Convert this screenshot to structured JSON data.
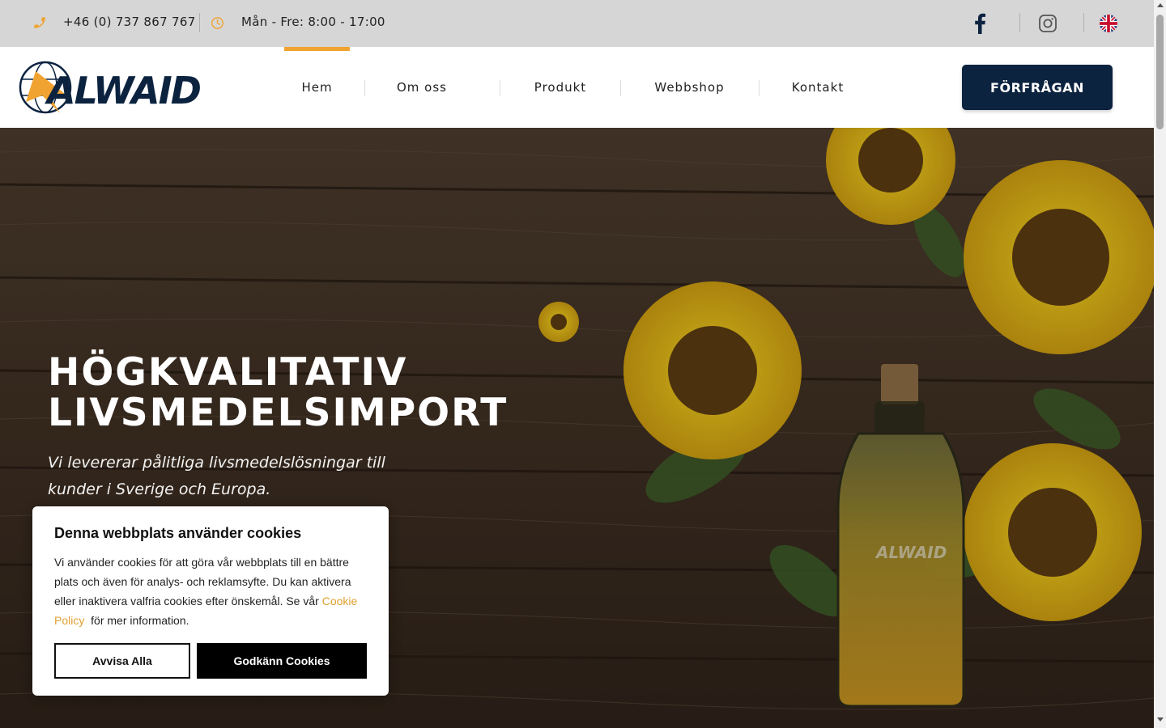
{
  "topbar": {
    "phone": "+46 (0) 737 867 767",
    "hours": "Mån - Fre: 8:00 - 17:00",
    "icons": [
      "phone-icon",
      "clock-icon",
      "facebook-icon",
      "instagram-icon",
      "uk-flag-icon"
    ]
  },
  "header": {
    "logo_text": "ALWAID",
    "nav": [
      {
        "label": "Hem",
        "active": true
      },
      {
        "label": "Om oss",
        "active": false
      },
      {
        "label": "Produkt",
        "active": false
      },
      {
        "label": "Webbshop",
        "active": false
      },
      {
        "label": "Kontakt",
        "active": false
      }
    ],
    "cta_label": "FÖRFRÅGAN"
  },
  "hero": {
    "title_line1": "HÖGKVALITATIV",
    "title_line2": "LIVSMEDELSIMPORT",
    "subtitle": "Vi levererar pålitliga livsmedelslösningar till kunder i Sverige och Europa.",
    "bottle_label": "ALWAID"
  },
  "cookie": {
    "title": "Denna webbplats använder cookies",
    "text_before": "Vi använder cookies för att göra vår webbplats till en bättre plats och även för analys- och reklamsyfte. Du kan aktivera eller inaktivera valfria cookies efter önskemål. Se vår ",
    "link": "Cookie Policy",
    "text_after": "  för mer information.",
    "reject_label": "Avvisa Alla",
    "accept_label": "Godkänn Cookies"
  },
  "colors": {
    "accent": "#f0a330",
    "navy": "#0c2340",
    "topbar_bg": "#d6d6d6"
  }
}
